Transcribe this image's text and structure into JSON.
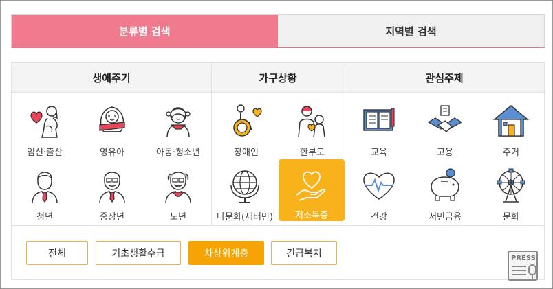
{
  "tabs": [
    {
      "label": "분류별 검색",
      "active": true
    },
    {
      "label": "지역별 검색",
      "active": false
    }
  ],
  "categories": [
    {
      "title": "생애주기",
      "items": [
        {
          "label": "임신·출산",
          "icon": "pregnancy-icon"
        },
        {
          "label": "영유아",
          "icon": "infant-icon"
        },
        {
          "label": "아동·청소년",
          "icon": "child-icon"
        },
        {
          "label": "청년",
          "icon": "young-adult-icon"
        },
        {
          "label": "중장년",
          "icon": "middle-aged-icon"
        },
        {
          "label": "노년",
          "icon": "senior-icon"
        }
      ]
    },
    {
      "title": "가구상황",
      "items": [
        {
          "label": "장애인",
          "icon": "wheelchair-icon"
        },
        {
          "label": "한부모",
          "icon": "single-parent-icon"
        },
        {
          "label": "다문화(새터민)",
          "icon": "globe-icon"
        },
        {
          "label": "저소득층",
          "icon": "hand-heart-icon",
          "selected": true
        }
      ]
    },
    {
      "title": "관심주제",
      "items": [
        {
          "label": "교육",
          "icon": "book-icon"
        },
        {
          "label": "고용",
          "icon": "handshake-icon"
        },
        {
          "label": "주거",
          "icon": "house-icon"
        },
        {
          "label": "건강",
          "icon": "heartbeat-icon"
        },
        {
          "label": "서민금융",
          "icon": "piggy-bank-icon"
        },
        {
          "label": "문화",
          "icon": "ferris-wheel-icon"
        }
      ]
    }
  ],
  "filters": [
    {
      "label": "전체",
      "active": false
    },
    {
      "label": "기초생활수급",
      "active": false
    },
    {
      "label": "차상위계층",
      "active": true
    },
    {
      "label": "긴급복지",
      "active": false
    }
  ],
  "watermark": {
    "label": "PRESS"
  },
  "colors": {
    "tab_active": "#f07a8e",
    "selected": "#f8b31c",
    "filter_active": "#f6a405",
    "accent_red": "#e8475b"
  }
}
